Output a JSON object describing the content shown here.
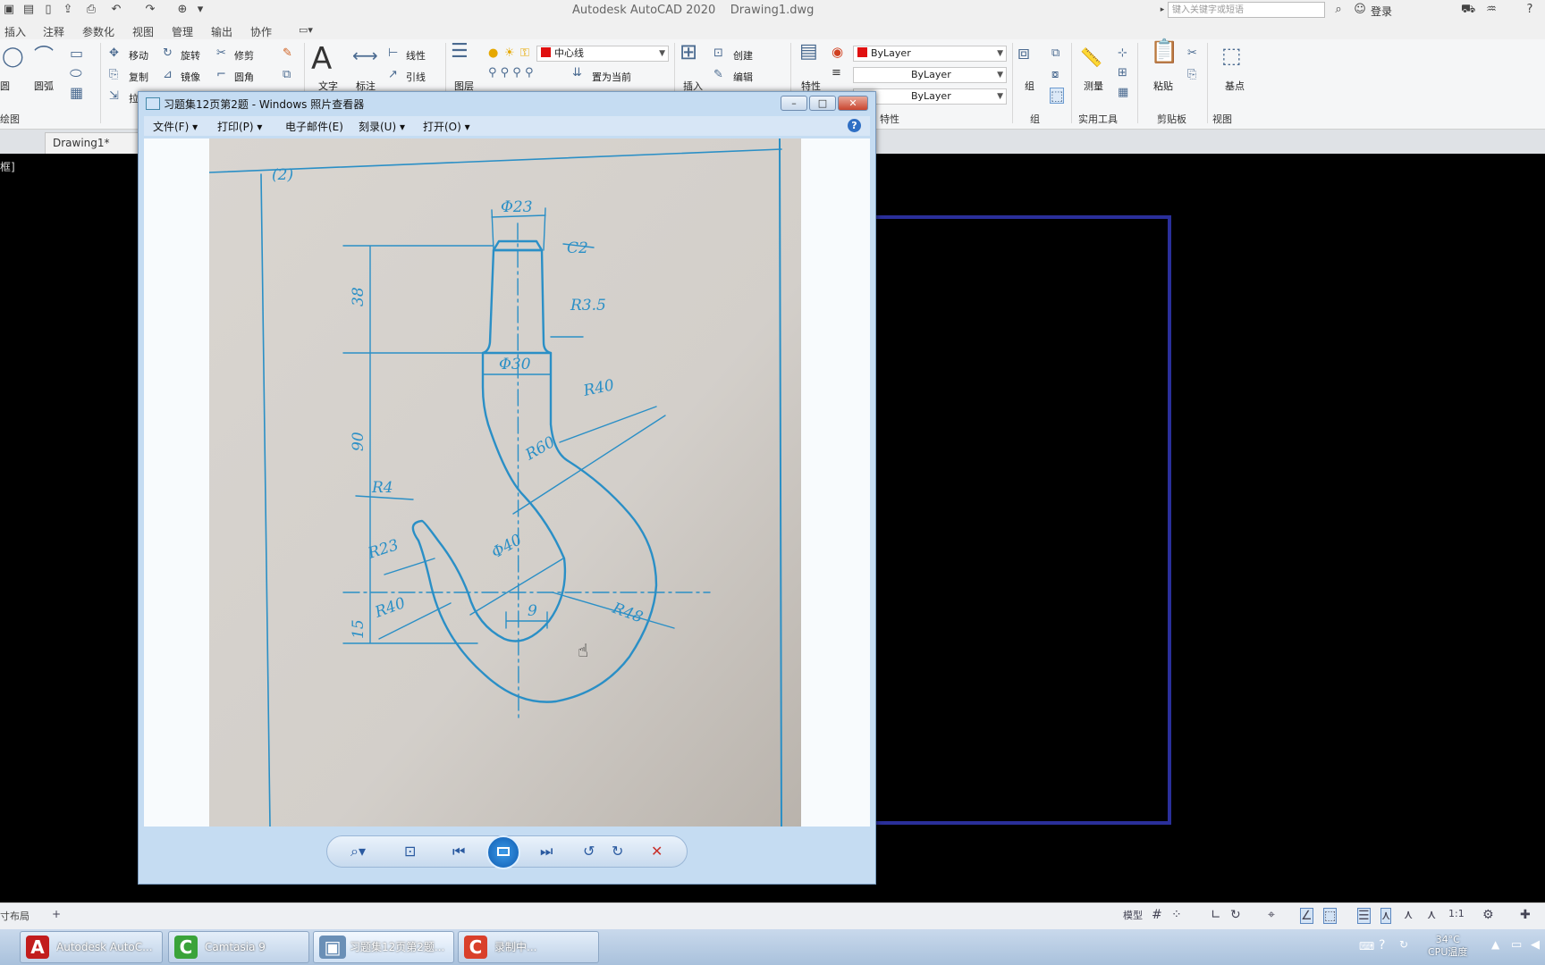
{
  "autocad": {
    "window_title": "Autodesk AutoCAD 2020    Drawing1.dwg",
    "search_placeholder": "键入关键字或短语",
    "login": "登录",
    "ribbon_tabs": [
      "插入",
      "注释",
      "参数化",
      "视图",
      "管理",
      "输出",
      "协作"
    ],
    "ribbon": {
      "draw": {
        "circle": "圆",
        "arc": "圆弧",
        "group": "绘图"
      },
      "modify": {
        "move": "移动",
        "rotate": "旋转",
        "trim": "修剪",
        "copy": "复制",
        "mirror": "镜像",
        "fillet": "圆角",
        "stretch": "拉伸"
      },
      "annotation": {
        "text": "文字",
        "dimension": "标注",
        "linear": "线性",
        "leader": "引线"
      },
      "layers": {
        "layer_properties": "图层",
        "current_layer": "中心线",
        "make_current": "置为当前"
      },
      "block": {
        "insert": "插入",
        "create": "创建",
        "edit": "编辑"
      },
      "properties": {
        "match": "特性",
        "color": "ByLayer",
        "linetype": "ByLayer",
        "lineweight": "ByLayer",
        "group": "特性"
      },
      "groups": {
        "group": "组",
        "label": "组"
      },
      "utilities": {
        "measure": "测量",
        "label": "实用工具"
      },
      "clipboard": {
        "paste": "粘贴",
        "label": "剪贴板"
      },
      "view": {
        "base": "基点",
        "label": "视图"
      }
    },
    "file_tab": "Drawing1*",
    "cmd_marker": "框]",
    "status": {
      "layout": "寸布局",
      "add": "+",
      "model": "模型",
      "scale": "1:1"
    }
  },
  "viewer": {
    "title": "习题集12页第2题 - Windows 照片查看器",
    "menu": [
      "文件(F)",
      "打印(P)",
      "电子邮件(E)",
      "刻录(U)",
      "打开(O)"
    ],
    "help": "?",
    "window_buttons": {
      "minimize": "–",
      "maximize": "□",
      "close": "✕"
    },
    "drawing": {
      "problem_no": "(2)",
      "dims": [
        "Φ23",
        "C2",
        "38",
        "R3.5",
        "Φ30",
        "R40",
        "90",
        "R60",
        "R4",
        "R23",
        "Φ40",
        "15",
        "R40",
        "9",
        "R48"
      ]
    }
  },
  "taskbar": {
    "items": [
      "Autodesk AutoC...",
      "Camtasia 9",
      "习题集12页第2题...",
      "录制中..."
    ],
    "cpu_temp": "34°C",
    "cpu_label": "CPU温度"
  },
  "colors": {
    "drawing_blue": "#2a8fc6",
    "viewport_border": "#2a2f9a",
    "paper": "#d7d4cf"
  }
}
